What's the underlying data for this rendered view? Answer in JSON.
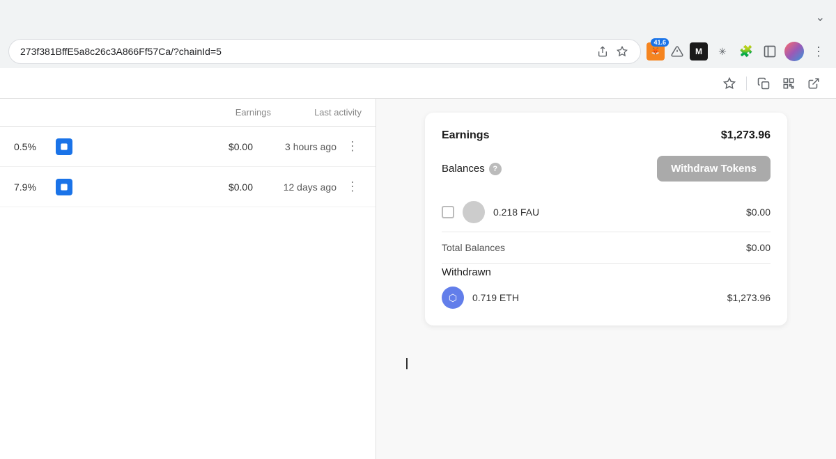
{
  "browser": {
    "chevron_label": "⌄",
    "address": "273f381BffE5a8c26c3A866Ff57Ca/?chainId=5",
    "badge_count": "41.6",
    "toolbar_items": [
      {
        "name": "star-icon",
        "icon": "☆"
      },
      {
        "name": "copy-icon",
        "icon": "⧉"
      },
      {
        "name": "qr-icon",
        "icon": "⊞"
      },
      {
        "name": "external-icon",
        "icon": "↗"
      }
    ]
  },
  "left_panel": {
    "columns": {
      "earnings": "Earnings",
      "last_activity": "Last activity"
    },
    "rows": [
      {
        "percent": "0.5%",
        "earnings": "$0.00",
        "activity": "3 hours ago"
      },
      {
        "percent": "7.9%",
        "earnings": "$0.00",
        "activity": "12 days ago"
      }
    ]
  },
  "earnings_card": {
    "title": "Earnings",
    "amount": "$1,273.96",
    "balances_label": "Balances",
    "withdraw_btn_label": "Withdraw Tokens",
    "token_row": {
      "amount": "0.218 FAU",
      "value": "$0.00"
    },
    "total_balances": {
      "label": "Total Balances",
      "value": "$0.00"
    },
    "withdrawn_section": {
      "title": "Withdrawn",
      "row": {
        "amount": "0.719 ETH",
        "value": "$1,273.96"
      }
    }
  }
}
